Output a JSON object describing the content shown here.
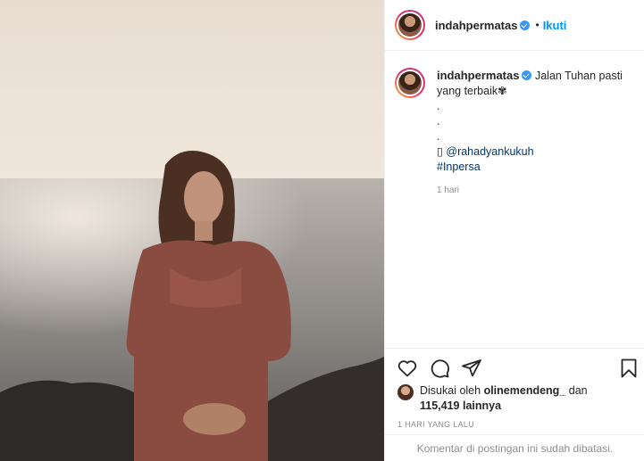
{
  "header": {
    "username": "indahpermatas",
    "dot": "•",
    "follow_label": "Ikuti"
  },
  "caption": {
    "username": "indahpermatas",
    "text_line1": "Jalan Tuhan pasti",
    "text_line2": "yang terbaik✾",
    "dot1": ".",
    "dot2": ".",
    "dot3": ".",
    "mention_prefix": "▯",
    "mention": "@rahadyankukuh",
    "hashtag": "#Inpersa",
    "time_ago": "1 hari"
  },
  "likes": {
    "prefix": "Disukai oleh",
    "user": "olinemendeng_",
    "and": "dan",
    "count": "115,419 lainnya"
  },
  "date": "1 HARI YANG LALU",
  "footer": "Komentar di postingan ini sudah dibatasi.",
  "icons": [
    "heart-icon",
    "comment-icon",
    "share-icon",
    "bookmark-icon",
    "verified-badge-icon"
  ],
  "colors": {
    "link": "#0095f6",
    "mention": "#00376b",
    "muted": "#8e8e8e",
    "verified": "#3897f0"
  }
}
